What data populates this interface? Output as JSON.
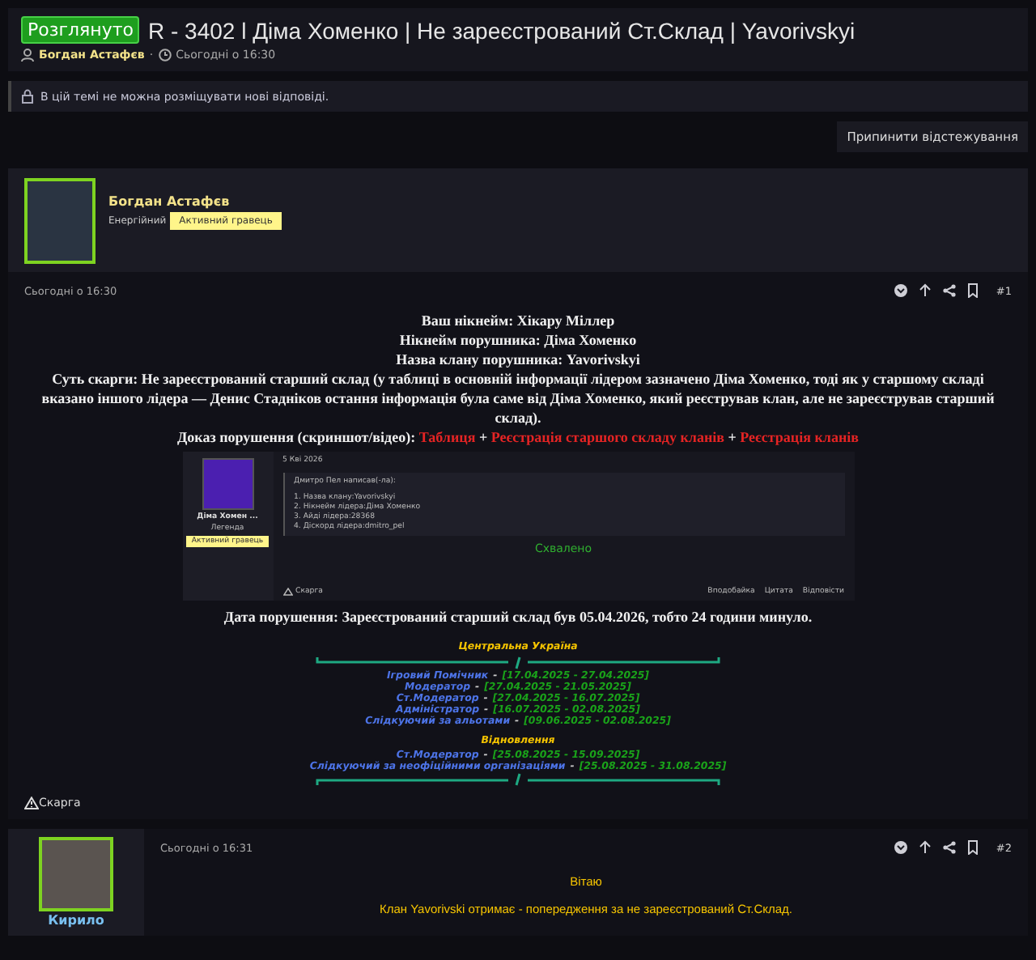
{
  "thread": {
    "status": "Розглянуто",
    "title": "R - 3402 l Діма Хоменко | Не зареєстрований Ст.Склад | Yavorivskyi",
    "author": "Богдан Астафєв",
    "separator": "·",
    "time": "Сьогодні о 16:30"
  },
  "notice": "В цій темі не можна розміщувати нові відповіді.",
  "unwatch_button": "Припинити відстежування",
  "post1": {
    "author": "Богдан Астафєв",
    "rank": "Енергійний",
    "badge": "Активний гравець",
    "time": "Сьогодні о 16:30",
    "number": "#1",
    "lines": [
      "Ваш нікнейм: Хікару Міллер",
      "Нікнейм порушника: Діма Хоменко",
      "Назва клану порушника: Yavorivskyi",
      "Суть скарги: Не зареєстрований старший склад (у таблиці в основній інформації лідером зазначено Діма Хоменко, тоді як у старшому складі вказано іншого лідера — Денис Стадніков остання інформація була саме від Діма Хоменко, який реєстрував клан, але не зареєстрував старший склад)."
    ],
    "evidence": {
      "label": "Доказ порушення (скриншот/відео):",
      "joiner": "+",
      "links": [
        "Таблиця",
        "Реєстрація старшого складу кланів",
        "Реєстрація кланів"
      ]
    },
    "embed": {
      "date": "5 Кві 2026",
      "author": "Діма Хомен ...",
      "rank": "Легенда",
      "badge": "Активний гравець",
      "quote_author": "Дмитро Пел написав(-ла):",
      "quote_lines": [
        "1. Назва клану:Yavorivskyi",
        "2. Нікнейм лідера:Діма Хоменко",
        "3. Айді лідера:28368",
        "4. Діскорд лідера:dmitro_pel"
      ],
      "approved": "Схвалено",
      "report": "Скарга",
      "actions": [
        "Вподобайка",
        "Цитата",
        "Відповісти"
      ]
    },
    "date_line": "Дата порушення: Зареєстрований старший склад був 05.04.2026, тобто 24 години минуло.",
    "sections": [
      {
        "heading": "Центральна Україна",
        "separator": "-",
        "roles": [
          {
            "title": "Ігровий Помічник",
            "dates": "[17.04.2025 - 27.04.2025]"
          },
          {
            "title": "Модератор",
            "dates": "[27.04.2025 - 21.05.2025]"
          },
          {
            "title": "Ст.Модератор",
            "dates": "[27.04.2025 - 16.07.2025]"
          },
          {
            "title": "Адміністратор",
            "dates": "[16.07.2025 - 02.08.2025]"
          },
          {
            "title": "Слідкуючий за альотами",
            "dates": "[09.06.2025 - 02.08.2025]"
          }
        ]
      },
      {
        "heading": "Відновлення",
        "separator": "-",
        "roles": [
          {
            "title": "Ст.Модератор",
            "dates": "[25.08.2025 - 15.09.2025]"
          },
          {
            "title": "Слідкуючий за неофіційними організаціями",
            "dates": "[25.08.2025 - 31.08.2025]"
          }
        ]
      }
    ],
    "report": "Скарга"
  },
  "post2": {
    "author": "Кирило",
    "time": "Сьогодні о 16:31",
    "number": "#2",
    "lines": [
      "Вітаю",
      "Клан Yavorivski отримає - попередження за не зареєстрований Ст.Склад."
    ]
  }
}
